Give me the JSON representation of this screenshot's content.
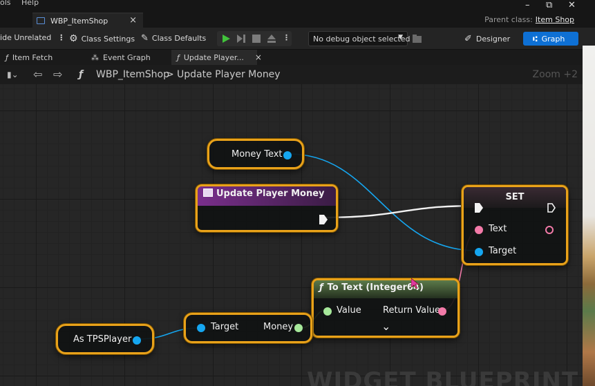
{
  "menu": {
    "items": [
      "ols",
      "Help"
    ]
  },
  "window": {
    "document_tab": "WBP_ItemShop",
    "document_tab_close": "×",
    "parent_class_label": "Parent class:",
    "parent_class_value": "Item Shop",
    "controls": [
      "–",
      "⧉",
      "✕"
    ]
  },
  "toolbar": {
    "hide_unrelated": "lide Unrelated",
    "class_settings": "Class Settings",
    "class_defaults": "Class Defaults",
    "debug_object": "No debug object selected",
    "designer": "Designer",
    "graph": "Graph"
  },
  "graph_tabs": [
    {
      "label": "Item Fetch",
      "icon": "function-icon"
    },
    {
      "label": "Event Graph",
      "icon": "event-graph-icon"
    },
    {
      "label": "Update Player...",
      "icon": "function-icon",
      "active": true
    }
  ],
  "breadcrumb": {
    "root": "WBP_ItemShop",
    "separator": ">",
    "current": "Update Player Money",
    "zoom": "Zoom +2"
  },
  "nodes": {
    "money_text": {
      "label": "Money Text"
    },
    "update_player_money": {
      "title": "Update Player Money"
    },
    "set": {
      "title": "SET",
      "text_pin": "Text",
      "target_pin": "Target"
    },
    "to_text": {
      "title": "To Text (Integer64)",
      "value_pin": "Value",
      "return_pin": "Return Value",
      "expand": "⌄"
    },
    "get_money": {
      "target_pin": "Target",
      "money_pin": "Money"
    },
    "as_tpsplayer": {
      "label": "As TPSPlayer"
    }
  },
  "watermark": "WIDGET BLUEPRINT",
  "colors": {
    "accent_blue": "#0e70d4",
    "selection_border": "#e9a21a",
    "object_pin": "#15a6f0",
    "text_pin": "#f27aa8",
    "int64_pin": "#a6e89a"
  }
}
